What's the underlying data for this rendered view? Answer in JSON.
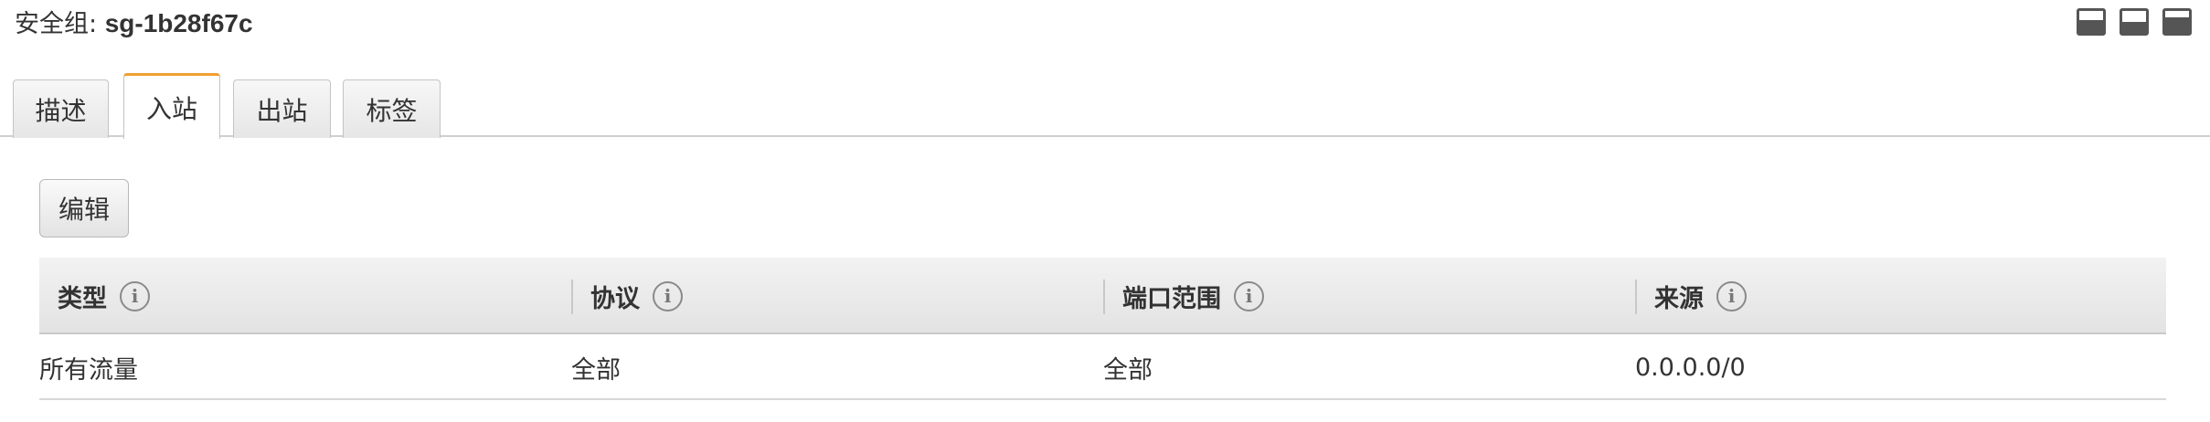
{
  "header": {
    "label": "安全组: ",
    "security_group_id": "sg-1b28f67c",
    "layout_icons": [
      "layout-bottom-large-icon",
      "layout-split-icon",
      "layout-top-small-icon"
    ]
  },
  "tabs": [
    {
      "label": "描述",
      "active": false
    },
    {
      "label": "入站",
      "active": true
    },
    {
      "label": "出站",
      "active": false
    },
    {
      "label": "标签",
      "active": false
    }
  ],
  "toolbar": {
    "edit_label": "编辑"
  },
  "table": {
    "columns": [
      {
        "label": "类型",
        "info_icon": "i"
      },
      {
        "label": "协议",
        "info_icon": "i"
      },
      {
        "label": "端口范围",
        "info_icon": "i"
      },
      {
        "label": "来源",
        "info_icon": "i"
      }
    ],
    "rows": [
      [
        "所有流量",
        "全部",
        "全部",
        "0.0.0.0/0"
      ]
    ]
  },
  "colors": {
    "active_tab_accent": "#f0a030",
    "header_bg": "#e8e8e8",
    "border": "#c4c4c4"
  }
}
